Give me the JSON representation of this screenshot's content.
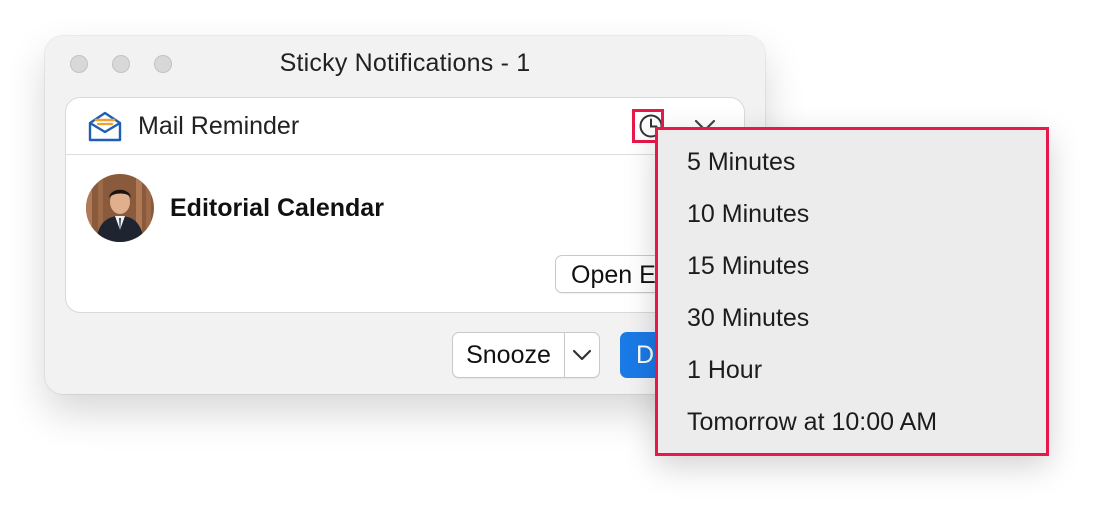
{
  "window": {
    "title": "Sticky Notifications - 1"
  },
  "card": {
    "header_title": "Mail Reminder",
    "header_icon": "mail-open-icon",
    "snooze_icon": "clock-icon",
    "collapse_icon": "chevron-down-icon",
    "event_title": "Editorial Calendar",
    "open_button_label": "Open E"
  },
  "actions": {
    "snooze_label": "Snooze",
    "dismiss_label": "D"
  },
  "snooze_menu": {
    "items": [
      "5 Minutes",
      "10 Minutes",
      "15 Minutes",
      "30 Minutes",
      "1 Hour",
      "Tomorrow at 10:00 AM"
    ]
  },
  "colors": {
    "accent": "#1a7ae6",
    "highlight": "#e8184b",
    "mail_icon_blue": "#1f5fb3",
    "mail_icon_orange": "#f0a030"
  }
}
